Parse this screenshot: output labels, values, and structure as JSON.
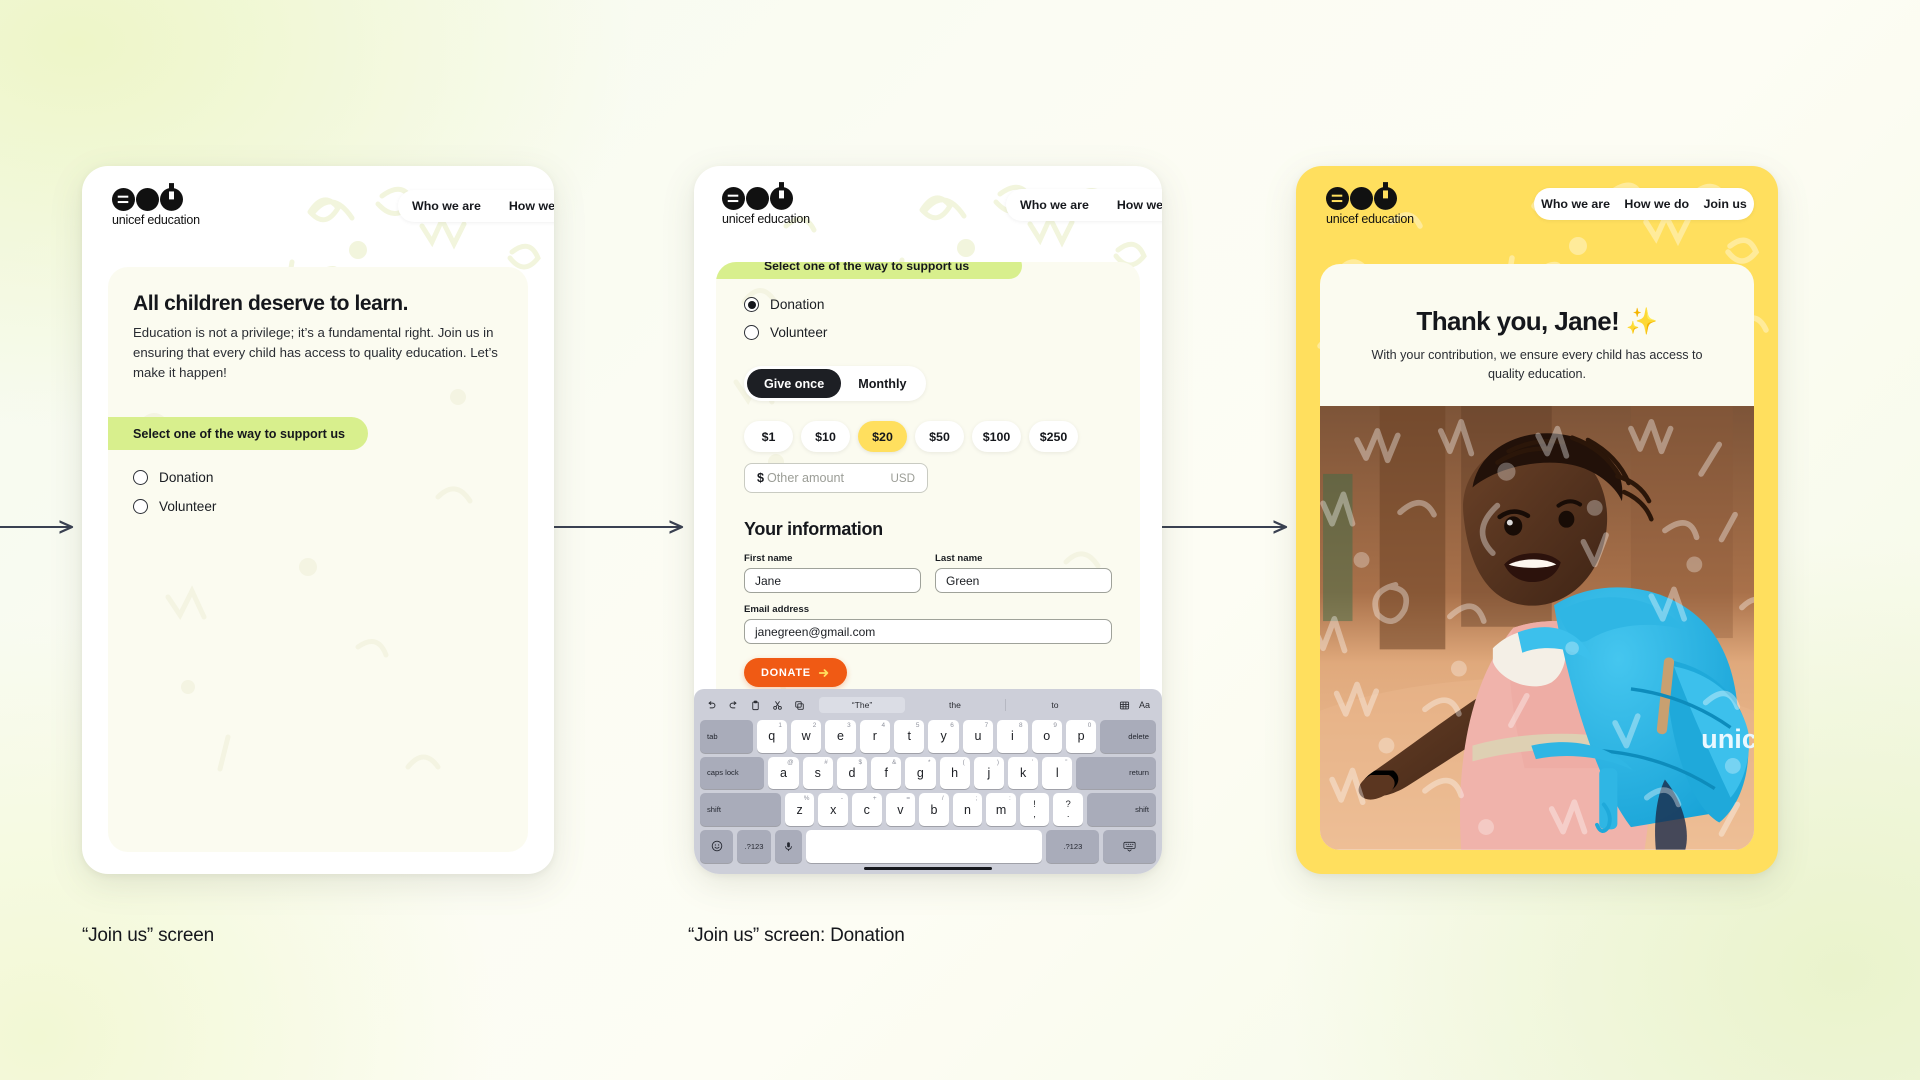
{
  "brand": {
    "name": "unicef education",
    "accent_yellow": "#ffdf5e",
    "accent_green": "#d8ef8d",
    "accent_orange": "#f05a14"
  },
  "nav": {
    "who": "Who we are",
    "how": "How we do",
    "join": "Join us"
  },
  "screen1": {
    "heading": "All children deserve to learn.",
    "body": "Education is not a privilege; it’s a fundamental right. Join us in ensuring that every child has access to quality education. Let’s make it happen!",
    "support_banner": "Select one of the way to support us",
    "options": [
      {
        "label": "Donation",
        "selected": false
      },
      {
        "label": "Volunteer",
        "selected": false
      }
    ]
  },
  "screen2": {
    "support_banner": "Select one of the way to support us",
    "options": [
      {
        "label": "Donation",
        "selected": true
      },
      {
        "label": "Volunteer",
        "selected": false
      }
    ],
    "frequency": [
      {
        "label": "Give once",
        "active": true
      },
      {
        "label": "Monthly",
        "active": false
      }
    ],
    "amounts": [
      {
        "label": "$1",
        "selected": false
      },
      {
        "label": "$10",
        "selected": false
      },
      {
        "label": "$20",
        "selected": true
      },
      {
        "label": "$50",
        "selected": false
      },
      {
        "label": "$100",
        "selected": false
      },
      {
        "label": "$250",
        "selected": false
      }
    ],
    "other_amount": {
      "prefix": "$",
      "placeholder": "Other amount",
      "currency": "USD",
      "value": ""
    },
    "form": {
      "title": "Your information",
      "first_name": {
        "label": "First name",
        "value": "Jane"
      },
      "last_name": {
        "label": "Last name",
        "value": "Green"
      },
      "email": {
        "label": "Email address",
        "value": "janegreen@gmail.com"
      }
    },
    "donate_button": "DONATE",
    "keyboard": {
      "suggestions": [
        "“The”",
        "the",
        "to"
      ],
      "row1": [
        {
          "k": "tab",
          "mod": true
        },
        {
          "k": "q",
          "sup": "1"
        },
        {
          "k": "w",
          "sup": "2"
        },
        {
          "k": "e",
          "sup": "3"
        },
        {
          "k": "r",
          "sup": "4"
        },
        {
          "k": "t",
          "sup": "5"
        },
        {
          "k": "y",
          "sup": "6"
        },
        {
          "k": "u",
          "sup": "7"
        },
        {
          "k": "i",
          "sup": "8"
        },
        {
          "k": "o",
          "sup": "9"
        },
        {
          "k": "p",
          "sup": "0"
        },
        {
          "k": "delete",
          "mod": true
        }
      ],
      "row2": [
        {
          "k": "caps lock",
          "mod": true
        },
        {
          "k": "a",
          "sup": "@"
        },
        {
          "k": "s",
          "sup": "#"
        },
        {
          "k": "d",
          "sup": "$"
        },
        {
          "k": "f",
          "sup": "&"
        },
        {
          "k": "g",
          "sup": "*"
        },
        {
          "k": "h",
          "sup": "("
        },
        {
          "k": "j",
          "sup": ")"
        },
        {
          "k": "k",
          "sup": "’"
        },
        {
          "k": "l",
          "sup": "”"
        },
        {
          "k": "return",
          "mod": true
        }
      ],
      "row3": [
        {
          "k": "shift",
          "mod": true
        },
        {
          "k": "z",
          "sup": "%"
        },
        {
          "k": "x",
          "sup": "-"
        },
        {
          "k": "c",
          "sup": "+"
        },
        {
          "k": "v",
          "sup": "="
        },
        {
          "k": "b",
          "sup": "/"
        },
        {
          "k": "n",
          "sup": ";"
        },
        {
          "k": "m",
          "sup": ":"
        },
        {
          "k": "!",
          "sub": ","
        },
        {
          "k": "?",
          "sub": "."
        },
        {
          "k": "shift",
          "mod": true
        }
      ],
      "row4": [
        {
          "k": "emoji-icon",
          "mod": true
        },
        {
          "k": ".?123",
          "mod": true
        },
        {
          "k": "mic-icon",
          "mod": true
        },
        {
          "k": "space"
        },
        {
          "k": ".?123",
          "mod": true
        },
        {
          "k": "keyboard-hide-icon",
          "mod": true
        }
      ]
    }
  },
  "screen3": {
    "heading": "Thank you, Jane! ✨",
    "body": "With your contribution, we ensure every child has access to quality education.",
    "photo_alt": "girl-with-unicef-backpack-photo",
    "photo_brand_text": "unicef"
  },
  "captions": {
    "one": "“Join us” screen",
    "two": "“Join us” screen: Donation"
  }
}
